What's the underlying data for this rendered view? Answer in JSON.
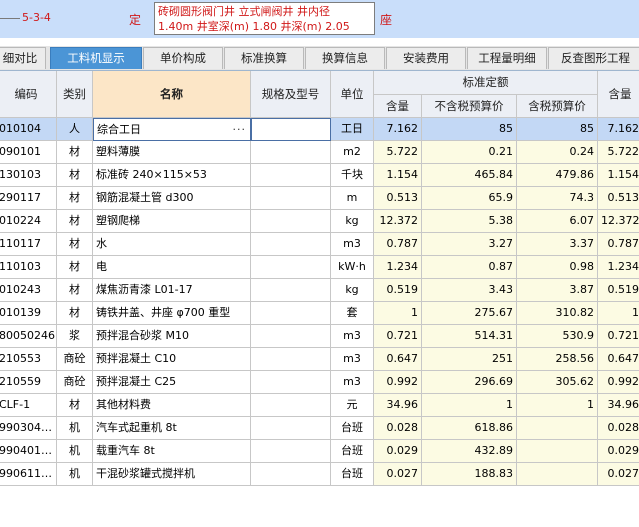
{
  "quota_row": {
    "code": "5-3-4",
    "unit_mark": "定",
    "description": "砖砌圆形阀门井 立式闸阀井 井内径\n1.40m 井室深(m) 1.80 井深(m) 2.05",
    "trailing_mark": "座"
  },
  "tabs": [
    {
      "label": "细对比",
      "active": false
    },
    {
      "label": "工料机显示",
      "active": true
    },
    {
      "label": "单价构成",
      "active": false
    },
    {
      "label": "标准换算",
      "active": false
    },
    {
      "label": "换算信息",
      "active": false
    },
    {
      "label": "安装费用",
      "active": false
    },
    {
      "label": "工程量明细",
      "active": false
    },
    {
      "label": "反查图形工程",
      "active": false
    }
  ],
  "table": {
    "headers": {
      "code": "编码",
      "category": "类别",
      "name": "名称",
      "spec": "规格及型号",
      "unit": "单位",
      "group": "标准定额",
      "qty": "含量",
      "price_ex": "不含税预算价",
      "price_in": "含税预算价",
      "qty2": "含量"
    },
    "rows": [
      {
        "code": "010104",
        "cat": "人",
        "name": "综合工日",
        "spec": "",
        "unit": "工日",
        "qty": "7.162",
        "ex": "85",
        "inc": "85",
        "qty2": "7.162",
        "selected": true
      },
      {
        "code": "090101",
        "cat": "材",
        "name": "塑料薄膜",
        "spec": "",
        "unit": "m2",
        "qty": "5.722",
        "ex": "0.21",
        "inc": "0.24",
        "qty2": "5.722"
      },
      {
        "code": "130103",
        "cat": "材",
        "name": "标准砖 240×115×53",
        "spec": "",
        "unit": "千块",
        "qty": "1.154",
        "ex": "465.84",
        "inc": "479.86",
        "qty2": "1.154"
      },
      {
        "code": "290117",
        "cat": "材",
        "name": "钢筋混凝土管 d300",
        "spec": "",
        "unit": "m",
        "qty": "0.513",
        "ex": "65.9",
        "inc": "74.3",
        "qty2": "0.513"
      },
      {
        "code": "010224",
        "cat": "材",
        "name": "塑钢爬梯",
        "spec": "",
        "unit": "kg",
        "qty": "12.372",
        "ex": "5.38",
        "inc": "6.07",
        "qty2": "12.372"
      },
      {
        "code": "110117",
        "cat": "材",
        "name": "水",
        "spec": "",
        "unit": "m3",
        "qty": "0.787",
        "ex": "3.27",
        "inc": "3.37",
        "qty2": "0.787"
      },
      {
        "code": "110103",
        "cat": "材",
        "name": "电",
        "spec": "",
        "unit": "kW·h",
        "qty": "1.234",
        "ex": "0.87",
        "inc": "0.98",
        "qty2": "1.234"
      },
      {
        "code": "010243",
        "cat": "材",
        "name": "煤焦沥青漆 L01-17",
        "spec": "",
        "unit": "kg",
        "qty": "0.519",
        "ex": "3.43",
        "inc": "3.87",
        "qty2": "0.519"
      },
      {
        "code": "010139",
        "cat": "材",
        "name": "铸铁井盖、井座 φ700 重型",
        "spec": "",
        "unit": "套",
        "qty": "1",
        "ex": "275.67",
        "inc": "310.82",
        "qty2": "1"
      },
      {
        "code": "80050246",
        "cat": "浆",
        "name": "预拌混合砂浆 M10",
        "spec": "",
        "unit": "m3",
        "qty": "0.721",
        "ex": "514.31",
        "inc": "530.9",
        "qty2": "0.721"
      },
      {
        "code": "210553",
        "cat": "商砼",
        "name": "预拌混凝土 C10",
        "spec": "",
        "unit": "m3",
        "qty": "0.647",
        "ex": "251",
        "inc": "258.56",
        "qty2": "0.647"
      },
      {
        "code": "210559",
        "cat": "商砼",
        "name": "预拌混凝土 C25",
        "spec": "",
        "unit": "m3",
        "qty": "0.992",
        "ex": "296.69",
        "inc": "305.62",
        "qty2": "0.992"
      },
      {
        "code": "CLF-1",
        "cat": "材",
        "name": "其他材料费",
        "spec": "",
        "unit": "元",
        "qty": "34.96",
        "ex": "1",
        "inc": "1",
        "qty2": "34.96"
      },
      {
        "code": "990304…",
        "cat": "机",
        "name": "汽车式起重机 8t",
        "spec": "",
        "unit": "台班",
        "qty": "0.028",
        "ex": "618.86",
        "inc": "",
        "qty2": "0.028"
      },
      {
        "code": "990401…",
        "cat": "机",
        "name": "载重汽车 8t",
        "spec": "",
        "unit": "台班",
        "qty": "0.029",
        "ex": "432.89",
        "inc": "",
        "qty2": "0.029"
      },
      {
        "code": "990611…",
        "cat": "机",
        "name": "干混砂浆罐式搅拌机",
        "spec": "",
        "unit": "台班",
        "qty": "0.027",
        "ex": "188.83",
        "inc": "",
        "qty2": "0.027"
      }
    ]
  }
}
